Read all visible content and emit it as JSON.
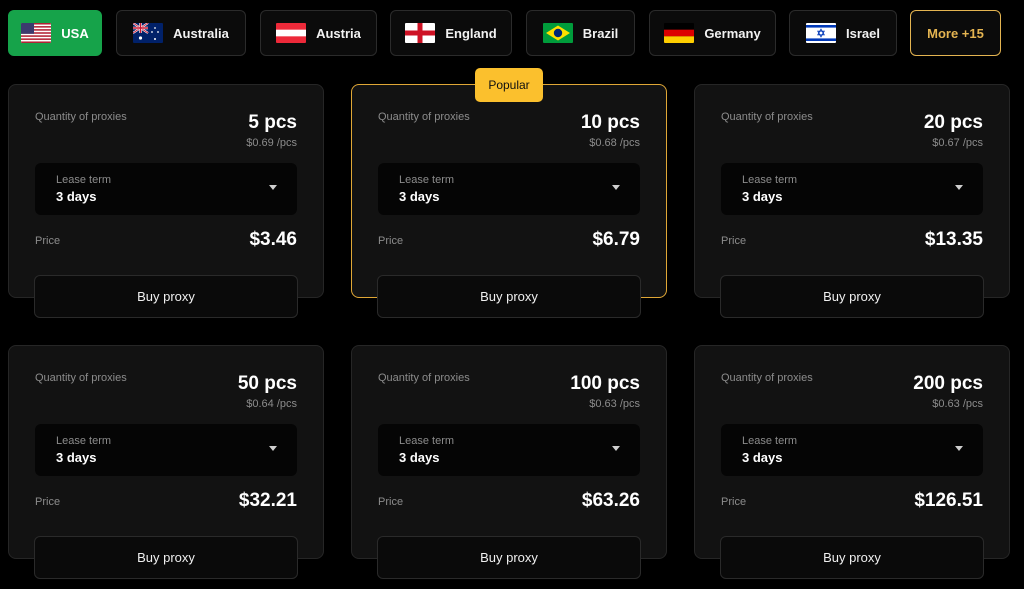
{
  "countries": [
    {
      "label": "USA",
      "flag": "usa-flag-icon",
      "active": true
    },
    {
      "label": "Australia",
      "flag": "australia-flag-icon"
    },
    {
      "label": "Austria",
      "flag": "austria-flag-icon"
    },
    {
      "label": "England",
      "flag": "england-flag-icon"
    },
    {
      "label": "Brazil",
      "flag": "brazil-flag-icon"
    },
    {
      "label": "Germany",
      "flag": "germany-flag-icon"
    },
    {
      "label": "Israel",
      "flag": "israel-flag-icon"
    }
  ],
  "more_label": "More +15",
  "popular_badge": "Popular",
  "colors": {
    "active": "#16a34a",
    "accent": "#e4b451",
    "badge": "#fbc02d",
    "background": "#000000",
    "card": "#121212"
  },
  "cards": [
    {
      "quantity_label": "Quantity of proxies",
      "quantity": "5 pcs",
      "unit_price": "$0.69 /pcs",
      "lease_label": "Lease term",
      "lease_value": "3 days",
      "price_label": "Price",
      "price": "$3.46",
      "buy_label": "Buy proxy"
    },
    {
      "quantity_label": "Quantity of proxies",
      "quantity": "10 pcs",
      "unit_price": "$0.68 /pcs",
      "lease_label": "Lease term",
      "lease_value": "3 days",
      "price_label": "Price",
      "price": "$6.79",
      "buy_label": "Buy proxy",
      "popular": true
    },
    {
      "quantity_label": "Quantity of proxies",
      "quantity": "20 pcs",
      "unit_price": "$0.67 /pcs",
      "lease_label": "Lease term",
      "lease_value": "3 days",
      "price_label": "Price",
      "price": "$13.35",
      "buy_label": "Buy proxy"
    },
    {
      "quantity_label": "Quantity of proxies",
      "quantity": "50 pcs",
      "unit_price": "$0.64 /pcs",
      "lease_label": "Lease term",
      "lease_value": "3 days",
      "price_label": "Price",
      "price": "$32.21",
      "buy_label": "Buy proxy"
    },
    {
      "quantity_label": "Quantity of proxies",
      "quantity": "100 pcs",
      "unit_price": "$0.63 /pcs",
      "lease_label": "Lease term",
      "lease_value": "3 days",
      "price_label": "Price",
      "price": "$63.26",
      "buy_label": "Buy proxy"
    },
    {
      "quantity_label": "Quantity of proxies",
      "quantity": "200 pcs",
      "unit_price": "$0.63 /pcs",
      "lease_label": "Lease term",
      "lease_value": "3 days",
      "price_label": "Price",
      "price": "$126.51",
      "buy_label": "Buy proxy"
    }
  ]
}
